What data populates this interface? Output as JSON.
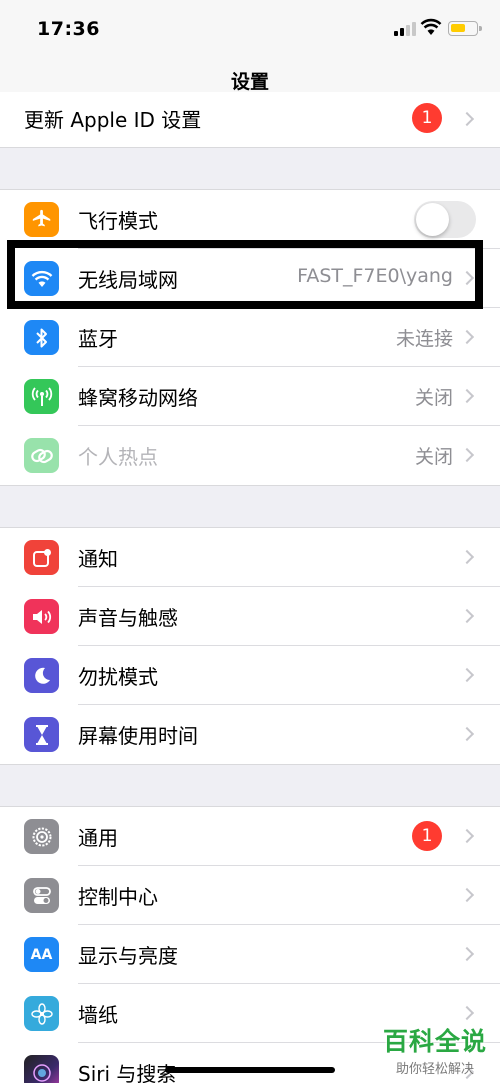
{
  "status": {
    "time": "17:36"
  },
  "nav": {
    "title": "设置"
  },
  "apple_id_row": {
    "label": "更新 Apple ID 设置",
    "badge": "1"
  },
  "group1": [
    {
      "label": "飞行模式",
      "icon": "airplane-icon",
      "color": "#ff9500",
      "toggle": false
    },
    {
      "label": "无线局域网",
      "icon": "wifi-icon",
      "color": "#1e88f5",
      "value": "FAST_F7E0\\yang"
    },
    {
      "label": "蓝牙",
      "icon": "bluetooth-icon",
      "color": "#1e88f5",
      "value": "未连接"
    },
    {
      "label": "蜂窝移动网络",
      "icon": "antenna-icon",
      "color": "#34c759",
      "value": "关闭"
    },
    {
      "label": "个人热点",
      "icon": "hotspot-link-icon",
      "color": "#34c759",
      "value": "关闭"
    }
  ],
  "group2": [
    {
      "label": "通知",
      "icon": "notification-icon",
      "color": "#f0433a"
    },
    {
      "label": "声音与触感",
      "icon": "speaker-icon",
      "color": "#f0335a"
    },
    {
      "label": "勿扰模式",
      "icon": "moon-icon",
      "color": "#5856d6"
    },
    {
      "label": "屏幕使用时间",
      "icon": "hourglass-icon",
      "color": "#5856d6"
    }
  ],
  "group3": [
    {
      "label": "通用",
      "icon": "gear-icon",
      "color": "#8e8e93",
      "badge": "1"
    },
    {
      "label": "控制中心",
      "icon": "switches-icon",
      "color": "#8e8e93"
    },
    {
      "label": "显示与亮度",
      "icon": "text-size-icon",
      "color": "#1e88f5",
      "icon_text": "AA"
    },
    {
      "label": "墙纸",
      "icon": "flower-icon",
      "color": "#35aadc"
    },
    {
      "label": "Siri 与搜索",
      "icon": "siri-icon",
      "color": "#222222"
    }
  ],
  "watermark": {
    "brand": "百科全说",
    "sub": "助你轻松解决"
  }
}
